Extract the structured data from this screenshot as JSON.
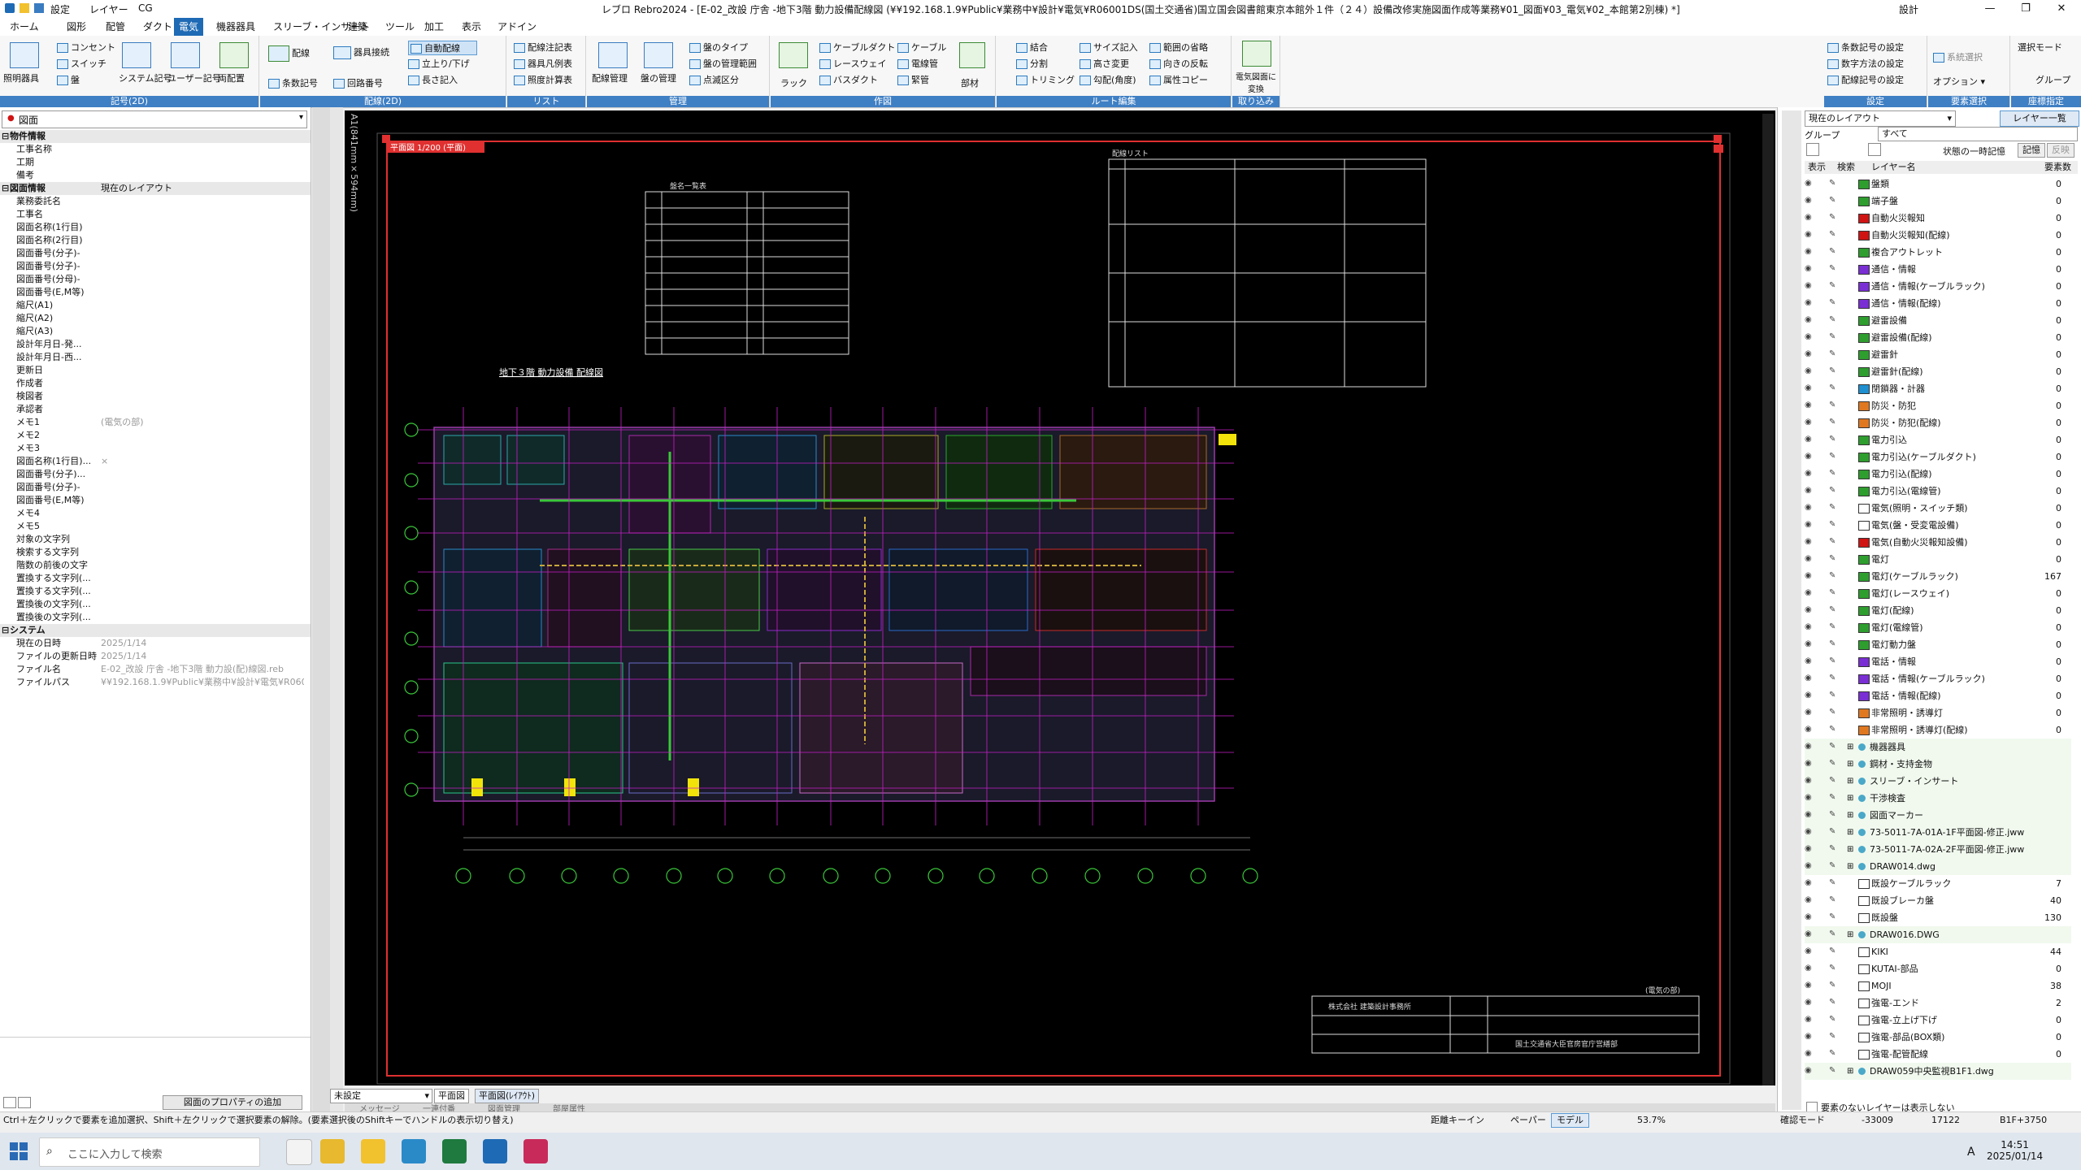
{
  "titlebar": {
    "quick_settings": "設定",
    "quick_layer": "レイヤー",
    "quick_cg": "CG",
    "title": "レブロ Rebro2024 - [E-02_改設 庁舎 -地下3階 動力設備配線図 (¥¥192.168.1.9¥Public¥業務中¥設計¥電気¥R06001DS(国土交通省)国立国会図書館東京本館外１件（２４）設備改修実施図面作成等業務¥01_図面¥03_電気¥02_本館第2別棟) *]",
    "settings": "設計"
  },
  "menus": [
    "ホーム",
    "図形",
    "配管",
    "ダクト",
    "電気",
    "機器器具",
    "スリーブ・インサート",
    "建築",
    "ツール",
    "加工",
    "表示",
    "アドイン"
  ],
  "menu_active": "電気",
  "ribbon": {
    "groups": [
      {
        "label": "記号(2D)",
        "buttons": [
          "照明器具",
          "コンセント",
          "スイッチ",
          "盤",
          "システム記号",
          "ユーザー記号",
          "両配置"
        ]
      },
      {
        "label": "配線(2D)",
        "buttons": [
          "配線",
          "器具接続",
          "自動配線",
          "立上り/下げ",
          "長さ記入",
          "条数記号",
          "回路番号"
        ]
      },
      {
        "label": "リスト",
        "buttons": [
          "配線注記表",
          "器具凡例表",
          "照度計算表"
        ]
      },
      {
        "label": "管理",
        "buttons": [
          "配線管理",
          "盤の管理",
          "盤のタイプ",
          "盤の管理範囲",
          "点滅区分"
        ]
      },
      {
        "label": "作図",
        "buttons": [
          "ラック",
          "ケーブルダクト",
          "レースウェイ",
          "バスダクト",
          "ケーブル",
          "電線管",
          "緊管",
          "部材"
        ]
      },
      {
        "label": "ルート編集",
        "buttons": [
          "結合",
          "分割",
          "トリミング",
          "サイズ記入",
          "高さ変更",
          "勾配(角度)",
          "範囲の省略",
          "向きの反転",
          "属性コピー"
        ]
      },
      {
        "label": "取り込み",
        "buttons": [
          "電気図面に変換"
        ]
      },
      {
        "label": "設定",
        "buttons": [
          "条数記号の設定",
          "数字方法の設定",
          "配線記号の設定"
        ]
      },
      {
        "label": "要素選択",
        "buttons": [
          "系統選択",
          "オプション"
        ]
      },
      {
        "label": "座標指定",
        "buttons": [
          "選択モード",
          "グループ"
        ]
      }
    ]
  },
  "left_panel": {
    "dropdown": "図面",
    "sections": [
      {
        "title": "物件情報",
        "rows": [
          [
            "工事名称",
            ""
          ],
          [
            "工期",
            ""
          ],
          [
            "備考",
            ""
          ]
        ]
      },
      {
        "title": "図面情報",
        "value": "現在のレイアウト",
        "rows": [
          [
            "業務委託名",
            ""
          ],
          [
            "工事名",
            ""
          ],
          [
            "図面名称(1行目)",
            ""
          ],
          [
            "図面名称(2行目)",
            ""
          ],
          [
            "図面番号(分子)-",
            ""
          ],
          [
            "図面番号(分子)-",
            ""
          ],
          [
            "図面番号(分母)-",
            ""
          ],
          [
            "図面番号(E,M等)",
            ""
          ],
          [
            "縮尺(A1)",
            ""
          ],
          [
            "縮尺(A2)",
            ""
          ],
          [
            "縮尺(A3)",
            ""
          ],
          [
            "設計年月日-発...",
            ""
          ],
          [
            "設計年月日-西...",
            ""
          ],
          [
            "更新日",
            ""
          ],
          [
            "作成者",
            ""
          ],
          [
            "検図者",
            ""
          ],
          [
            "承認者",
            ""
          ],
          [
            "メモ1",
            "(電気の部)"
          ],
          [
            "メモ2",
            ""
          ],
          [
            "メモ3",
            ""
          ],
          [
            "図面名称(1行目)...",
            "×"
          ],
          [
            "図面番号(分子)...",
            ""
          ],
          [
            "図面番号(分子)-",
            ""
          ],
          [
            "図面番号(E,M等)",
            ""
          ],
          [
            "メモ4",
            ""
          ],
          [
            "メモ5",
            ""
          ],
          [
            "対象の文字列",
            ""
          ],
          [
            "検索する文字列",
            ""
          ],
          [
            "階数の前後の文字",
            ""
          ],
          [
            "置換する文字列(...",
            ""
          ],
          [
            "置換する文字列(...",
            ""
          ],
          [
            "置換後の文字列(...",
            ""
          ],
          [
            "置換後の文字列(...",
            ""
          ]
        ]
      },
      {
        "title": "システム",
        "rows": [
          [
            "現在の日時",
            "2025/1/14"
          ],
          [
            "ファイルの更新日時",
            "2025/1/14"
          ],
          [
            "ファイル名",
            "E-02_改設 庁舎 -地下3階 動力設(配)線図.reb"
          ],
          [
            "ファイルパス",
            "¥¥192.168.1.9¥Public¥業務中¥設計¥電気¥R06001..."
          ]
        ]
      }
    ],
    "footer_button": "図面のプロパティの追加"
  },
  "canvas": {
    "sheet_label": "A1(841mm×594mm)",
    "view_label": "平面図 1/200 (平面)",
    "legend_title": "盤名一覧表",
    "notes_title": "配線リスト",
    "plan_title": "地下３階 動力設備 配線図",
    "company": "株式会社 建築設計事務所",
    "client": "国土交通省大臣官房官庁営繕部",
    "stamp": "(電気の部)"
  },
  "layout_tabs": [
    "未設定",
    "平面図",
    "平面図(ﾚｲｱｳﾄ)"
  ],
  "bottom_tabs": [
    "メッセージ",
    "一連付番",
    "図面管理",
    "部屋属性"
  ],
  "right_panel": {
    "layout_select": "現在のレイアウト",
    "layer_list_btn": "レイヤー一覧",
    "group_label": "グループ",
    "group_value": "すべて",
    "state_label": "状態の一時記憶",
    "memo_btn": "記憶",
    "reflect_btn": "反映",
    "columns": [
      "表示",
      "検索",
      "レイヤー名",
      "要素数"
    ],
    "footer": "要素のないレイヤーは表示しない",
    "layers": [
      {
        "name": "盤類",
        "color": "#2e9e2e",
        "count": "0"
      },
      {
        "name": "端子盤",
        "color": "#2e9e2e",
        "count": "0"
      },
      {
        "name": "自動火災報知",
        "color": "#d01414",
        "count": "0"
      },
      {
        "name": "自動火災報知(配線)",
        "color": "#d01414",
        "count": "0"
      },
      {
        "name": "複合アウトレット",
        "color": "#2e9e2e",
        "count": "0"
      },
      {
        "name": "通信・情報",
        "color": "#7a2fd4",
        "count": "0"
      },
      {
        "name": "通信・情報(ケーブルラック)",
        "color": "#7a2fd4",
        "count": "0"
      },
      {
        "name": "通信・情報(配線)",
        "color": "#7a2fd4",
        "count": "0"
      },
      {
        "name": "避雷設備",
        "color": "#2e9e2e",
        "count": "0"
      },
      {
        "name": "避雷設備(配線)",
        "color": "#2e9e2e",
        "count": "0"
      },
      {
        "name": "避雷針",
        "color": "#2e9e2e",
        "count": "0"
      },
      {
        "name": "避雷針(配線)",
        "color": "#2e9e2e",
        "count": "0"
      },
      {
        "name": "閉鎖器・計器",
        "color": "#1e8fd0",
        "count": "0"
      },
      {
        "name": "防災・防犯",
        "color": "#e07820",
        "count": "0"
      },
      {
        "name": "防災・防犯(配線)",
        "color": "#e07820",
        "count": "0"
      },
      {
        "name": "電力引込",
        "color": "#2e9e2e",
        "count": "0"
      },
      {
        "name": "電力引込(ケーブルダクト)",
        "color": "#2e9e2e",
        "count": "0"
      },
      {
        "name": "電力引込(配線)",
        "color": "#2e9e2e",
        "count": "0"
      },
      {
        "name": "電力引込(電線管)",
        "color": "#2e9e2e",
        "count": "0"
      },
      {
        "name": "電気(照明・スイッチ類)",
        "color": "#ffffff",
        "count": "0"
      },
      {
        "name": "電気(盤・受変電設備)",
        "color": "#ffffff",
        "count": "0"
      },
      {
        "name": "電気(自動火災報知設備)",
        "color": "#d01414",
        "count": "0"
      },
      {
        "name": "電灯",
        "color": "#2e9e2e",
        "count": "0"
      },
      {
        "name": "電灯(ケーブルラック)",
        "color": "#2e9e2e",
        "count": "167"
      },
      {
        "name": "電灯(レースウェイ)",
        "color": "#2e9e2e",
        "count": "0"
      },
      {
        "name": "電灯(配線)",
        "color": "#2e9e2e",
        "count": "0"
      },
      {
        "name": "電灯(電線管)",
        "color": "#2e9e2e",
        "count": "0"
      },
      {
        "name": "電灯動力盤",
        "color": "#2e9e2e",
        "count": "0"
      },
      {
        "name": "電話・情報",
        "color": "#7a2fd4",
        "count": "0"
      },
      {
        "name": "電話・情報(ケーブルラック)",
        "color": "#7a2fd4",
        "count": "0"
      },
      {
        "name": "電話・情報(配線)",
        "color": "#7a2fd4",
        "count": "0"
      },
      {
        "name": "非常照明・誘導灯",
        "color": "#e07820",
        "count": "0"
      },
      {
        "name": "非常照明・誘導灯(配線)",
        "color": "#e07820",
        "count": "0"
      }
    ],
    "groups": [
      {
        "name": "機器器具",
        "count": ""
      },
      {
        "name": "鋼材・支持金物",
        "count": ""
      },
      {
        "name": "スリーブ・インサート",
        "count": ""
      },
      {
        "name": "干渉検査",
        "count": ""
      },
      {
        "name": "図面マーカー",
        "count": ""
      },
      {
        "name": "73-5011-7A-01A-1F平面図-修正.jww",
        "count": ""
      },
      {
        "name": "73-5011-7A-02A-2F平面図-修正.jww",
        "count": ""
      },
      {
        "name": "DRAW014.dwg",
        "count": ""
      }
    ],
    "sublayers1": [
      {
        "name": "既設ケーブルラック",
        "color": "#ffffff",
        "count": "7"
      },
      {
        "name": "既設ブレーカ盤",
        "color": "#ffffff",
        "count": "40"
      },
      {
        "name": "既設盤",
        "color": "#ffffff",
        "count": "130"
      }
    ],
    "group2": "DRAW016.DWG",
    "sublayers2": [
      {
        "name": "KIKI",
        "color": "#ffffff",
        "count": "44"
      },
      {
        "name": "KUTAI-部品",
        "color": "#ffffff",
        "count": "0"
      },
      {
        "name": "MOJI",
        "color": "#ffffff",
        "count": "38"
      },
      {
        "name": "強電-エンド",
        "color": "#ffffff",
        "count": "2"
      },
      {
        "name": "強電-立上げ下げ",
        "color": "#ffffff",
        "count": "0"
      },
      {
        "name": "強電-部品(BOX類)",
        "color": "#ffffff",
        "count": "0"
      },
      {
        "name": "強電-配管配線",
        "color": "#ffffff",
        "count": "0"
      }
    ],
    "group3": "DRAW059中央監視B1F1.dwg"
  },
  "statusbar": {
    "hint": "Ctrl＋左クリックで要素を追加選択、Shift＋左クリックで選択要素の解除。(要素選択後のShiftキーでハンドルの表示切り替え)",
    "mode1": "距離キーイン",
    "paper": "ペーパー",
    "model": "モデル",
    "zoom": "53.7%",
    "coord_mode": "確認モード",
    "x": "-33009",
    "y": "17122",
    "floor": "B1F+3750"
  },
  "taskbar": {
    "search_placeholder": "ここに入力して検索",
    "time": "14:51",
    "date": "2025/01/14",
    "ime": "A"
  }
}
